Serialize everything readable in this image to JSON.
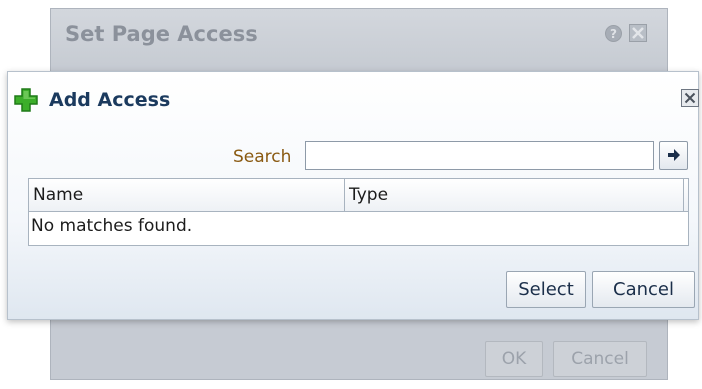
{
  "background_dialog": {
    "title": "Set Page Access",
    "help_glyph": "?",
    "ok_label": "OK",
    "cancel_label": "Cancel"
  },
  "modal": {
    "title": "Add Access",
    "search": {
      "label": "Search",
      "value": "",
      "placeholder": ""
    },
    "table": {
      "columns": [
        "Name",
        "Type"
      ],
      "empty_message": "No matches found."
    },
    "buttons": {
      "select_label": "Select",
      "cancel_label": "Cancel"
    }
  },
  "icons": {
    "add": "plus-icon",
    "close": "close-icon",
    "help": "help-icon",
    "go": "arrow-right-icon"
  },
  "colors": {
    "title_text": "#1b3a5e",
    "search_label": "#8a5a12",
    "plus_green": "#3cae2a",
    "disabled_overlay": "#c6cbd3"
  }
}
